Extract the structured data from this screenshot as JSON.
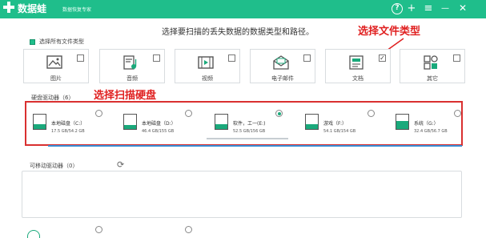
{
  "app": {
    "title": "数据蛙",
    "subtitle": "数据恢复专家",
    "help_icon": "?",
    "plus_icon": "+",
    "menu_icon": "≡",
    "minimize_icon": "—",
    "close_icon": "✕"
  },
  "instruction": "选择要扫描的丢失数据的数据类型和路径。",
  "annotations": {
    "file_type": "选择文件类型",
    "disk": "选择扫描硬盘"
  },
  "select_all": {
    "label": "选择所有文件类型",
    "checked": true
  },
  "file_types": [
    {
      "label": "图片",
      "icon": "image-icon",
      "checked": false
    },
    {
      "label": "音频",
      "icon": "audio-icon",
      "checked": false
    },
    {
      "label": "视频",
      "icon": "video-icon",
      "checked": false
    },
    {
      "label": "电子邮件",
      "icon": "email-icon",
      "checked": false
    },
    {
      "label": "文档",
      "icon": "document-icon",
      "checked": true,
      "check_mark": "✓"
    },
    {
      "label": "其它",
      "icon": "other-icon",
      "checked": false
    }
  ],
  "hard_drives": {
    "label": "硬盘驱动器（6）",
    "items": [
      {
        "name": "本地磁盘（C:）",
        "size": "17.5 GB/54.2 GB",
        "fill": 0.32,
        "selected": false
      },
      {
        "name": "本地磁盘（D:）",
        "size": "46.4 GB/155 GB",
        "fill": 0.3,
        "selected": false
      },
      {
        "name": "软件，工一(E:)",
        "size": "52.5 GB/156 GB",
        "fill": 0.34,
        "selected": true
      },
      {
        "name": "游戏（F:）",
        "size": "54.1 GB/154 GB",
        "fill": 0.35,
        "selected": false
      },
      {
        "name": "系统（G:）",
        "size": "32.4 GB/56.7 GB",
        "fill": 0.57,
        "selected": false
      }
    ]
  },
  "removable": {
    "label": "可移动驱动器（0）",
    "refresh_icon": "⟳"
  },
  "colors": {
    "titlebar": "#1fbe8b",
    "accent": "#1aa97b",
    "annotation": "#e02020"
  }
}
